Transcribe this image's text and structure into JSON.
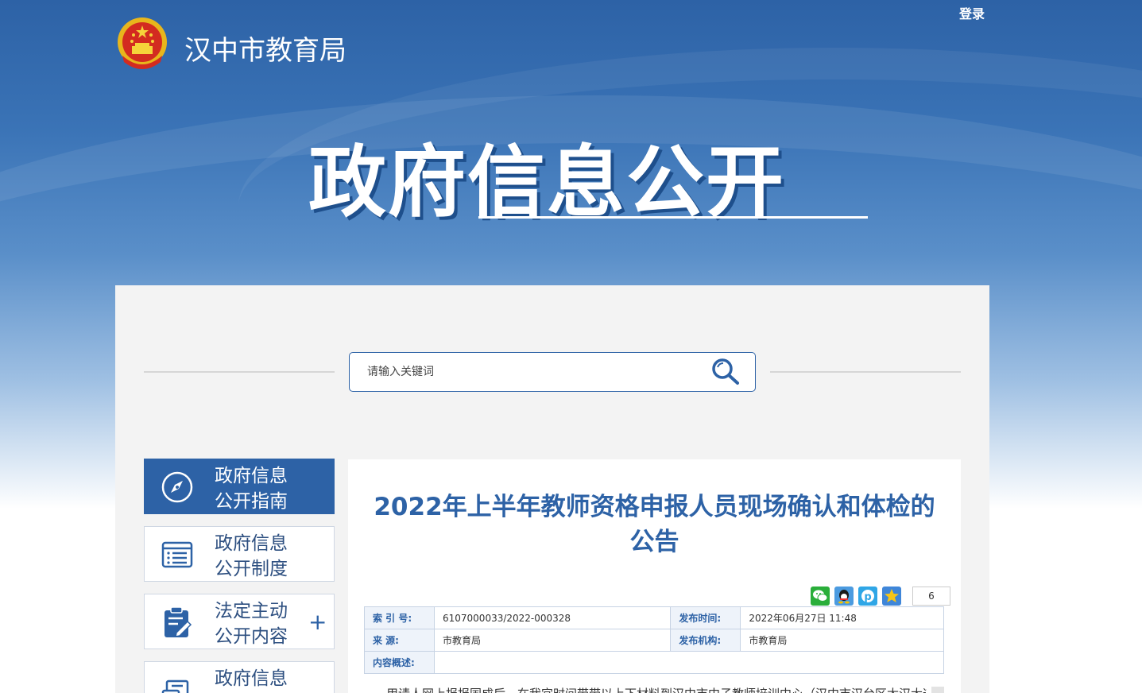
{
  "header": {
    "site_name": "汉中市教育局",
    "login_label": "登录",
    "big_title": "政府信息公开"
  },
  "search": {
    "placeholder": "请输入关键词"
  },
  "sidebar": {
    "items": [
      {
        "line1": "政府信息",
        "line2": "公开指南"
      },
      {
        "line1": "政府信息",
        "line2": "公开制度"
      },
      {
        "line1": "法定主动",
        "line2": "公开内容",
        "plus": "+"
      },
      {
        "line1": "政府信息",
        "line2": ""
      }
    ]
  },
  "article": {
    "title": "2022年上半年教师资格申报人员现场确认和体检的公告",
    "share_count": "6",
    "meta": {
      "index_label": "索 引 号:",
      "index_value": "6107000033/2022-000328",
      "publish_time_label": "发布时间:",
      "publish_time_value": "2022年06月27日 11:48",
      "source_label": "来    源:",
      "source_value": "市教育局",
      "org_label": "发布机构:",
      "org_value": "市教育局",
      "summary_label": "内容概述:",
      "summary_value": ""
    },
    "body_first_line": "用请人网上报报国成后，在我宜时间带带以上下材料到汉中市中子教师培训中心（汉中市汉台区太汉大道b/U号"
  },
  "colors": {
    "brand_blue": "#2d62a6",
    "panel_bg": "#f3f3f3"
  },
  "icons": {
    "share": [
      "wechat-icon",
      "qq-icon",
      "qzone-icon",
      "weibo-icon"
    ],
    "sidebar": [
      "compass-icon",
      "list-document-icon",
      "clipboard-edit-icon",
      "document-stack-icon"
    ]
  }
}
